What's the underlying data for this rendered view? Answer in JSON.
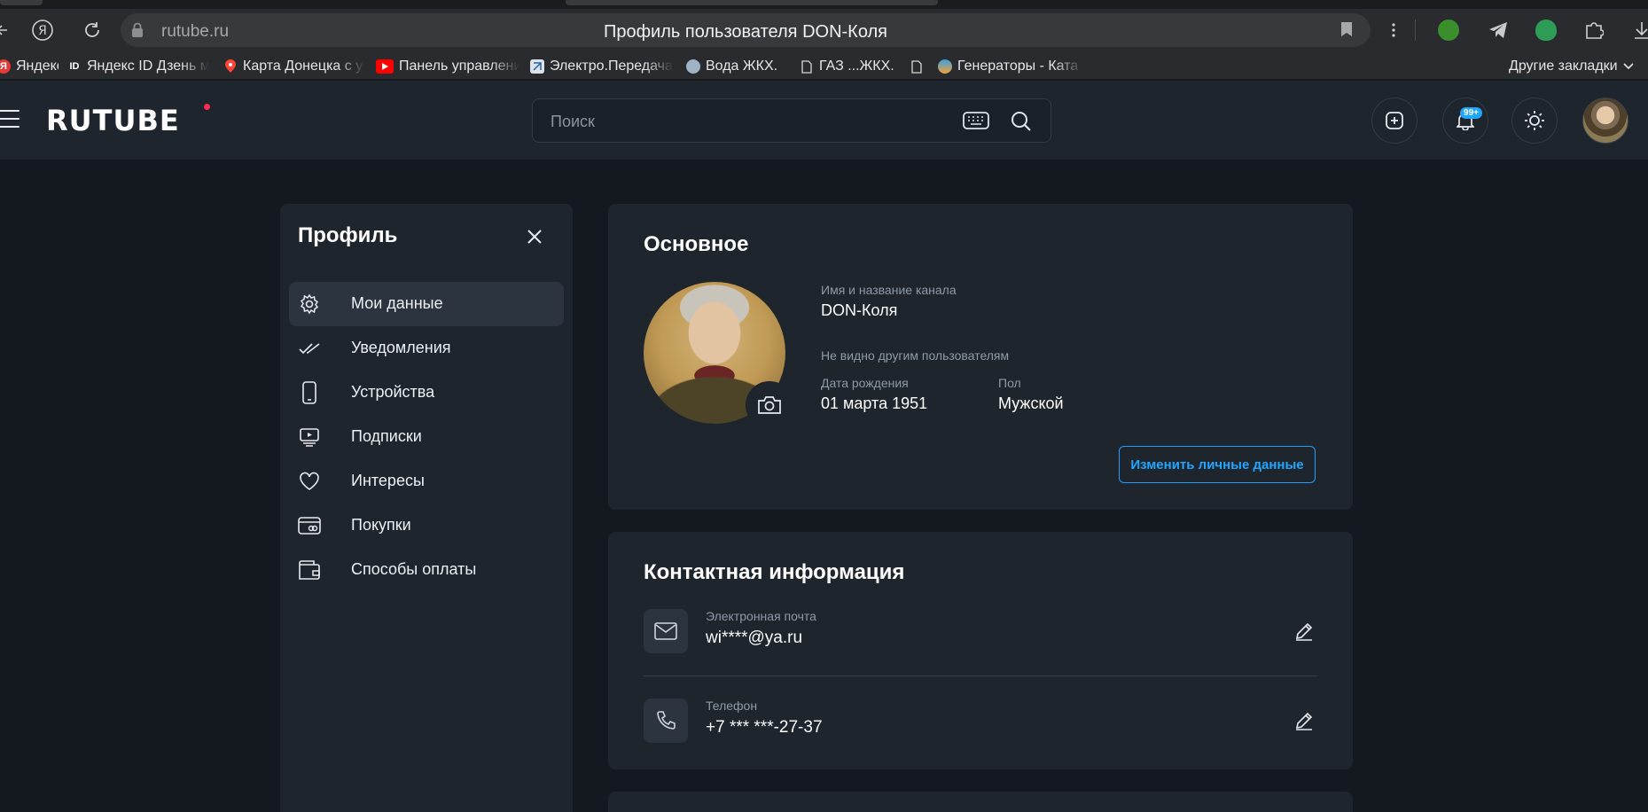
{
  "browser": {
    "host": "rutube.ru",
    "page_title": "Профиль пользователя DON-Коля",
    "bookmarks": [
      {
        "label": "Яндекс",
        "icon": "yandex-icon"
      },
      {
        "label": "Яндекс ID Дзень м",
        "icon": "id-icon"
      },
      {
        "label": "Карта Донецка с у",
        "icon": "map-pin-icon"
      },
      {
        "label": "Панель управлени",
        "icon": "youtube-icon"
      },
      {
        "label": "Электро.Передача",
        "icon": "electro-icon"
      },
      {
        "label": "Вода  ЖКХ.",
        "icon": "water-icon"
      },
      {
        "label": "ГАЗ ...ЖКХ.",
        "icon": "page-icon"
      },
      {
        "label": "",
        "icon": "page-icon"
      },
      {
        "label": "Генераторы - Ката",
        "icon": "generator-icon"
      }
    ],
    "other_bookmarks": "Другие закладки"
  },
  "header": {
    "logo": "RUTUBE",
    "search_placeholder": "Поиск",
    "notifications_badge": "99+"
  },
  "sidebar": {
    "title": "Профиль",
    "items": [
      {
        "label": "Мои данные",
        "icon": "gear-icon",
        "active": true
      },
      {
        "label": "Уведомления",
        "icon": "double-check-icon",
        "active": false
      },
      {
        "label": "Устройства",
        "icon": "phone-device-icon",
        "active": false
      },
      {
        "label": "Подписки",
        "icon": "subscriptions-icon",
        "active": false
      },
      {
        "label": "Интересы",
        "icon": "heart-icon",
        "active": false
      },
      {
        "label": "Покупки",
        "icon": "card-icon",
        "active": false
      },
      {
        "label": "Способы оплаты",
        "icon": "wallet-icon",
        "active": false
      }
    ]
  },
  "basic": {
    "title": "Основное",
    "name_label": "Имя и название канала",
    "name_value": "DON-Коля",
    "hidden_note": "Не видно другим пользователям",
    "birth_label": "Дата рождения",
    "birth_value": "01 марта 1951",
    "gender_label": "Пол",
    "gender_value": "Мужской",
    "edit_button": "Изменить личные данные"
  },
  "contact": {
    "title": "Контактная информация",
    "email_label": "Электронная почта",
    "email_value": "wi****@ya.ru",
    "phone_label": "Телефон",
    "phone_value": "+7 *** ***-27-37"
  },
  "colors": {
    "page_bg": "#14191f",
    "card_bg": "#1e252d",
    "accent": "#1fa6ff",
    "logo_dot": "#ff2b55"
  }
}
